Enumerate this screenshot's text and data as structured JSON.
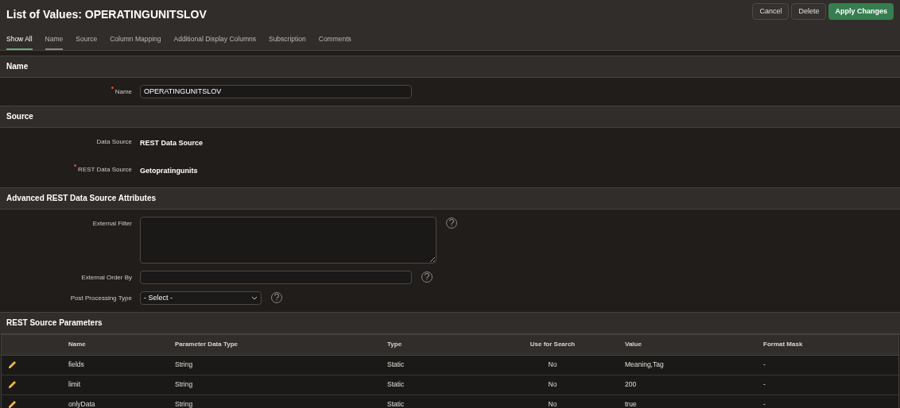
{
  "title": "List of Values: OPERATINGUNITSLOV",
  "buttons": [
    {
      "label": "Cancel",
      "kind": "plain"
    },
    {
      "label": "Delete",
      "kind": "plain"
    },
    {
      "label": "Apply Changes",
      "kind": "primary"
    }
  ],
  "tabs": [
    {
      "label": "Show All",
      "selected": true,
      "underlined": true
    },
    {
      "label": "Name",
      "selected": false,
      "underlined": true
    },
    {
      "label": "Source",
      "selected": false,
      "underlined": false
    },
    {
      "label": "Column Mapping",
      "selected": false,
      "underlined": false
    },
    {
      "label": "Additional Display Columns",
      "selected": false,
      "underlined": false
    },
    {
      "label": "Subscription",
      "selected": false,
      "underlined": false
    },
    {
      "label": "Comments",
      "selected": false,
      "underlined": false
    }
  ],
  "sections": [
    {
      "title": "Name",
      "fields": [
        {
          "label": "Name",
          "required": true,
          "kind": "input",
          "value": "OPERATINGUNITSLOV"
        }
      ]
    },
    {
      "title": "Source",
      "fields": [
        {
          "label": "Data Source",
          "required": false,
          "kind": "display",
          "value": "REST Data Source"
        },
        {
          "label": "REST Data Source",
          "required": true,
          "kind": "display",
          "value": "Getopratingunits"
        }
      ]
    },
    {
      "title": "Advanced REST Data Source Attributes",
      "fields": [
        {
          "label": "External Filter",
          "required": false,
          "kind": "textarea",
          "help": true
        },
        {
          "label": "External Order By",
          "required": false,
          "kind": "input",
          "help": true
        },
        {
          "label": "Post Processing Type",
          "required": false,
          "kind": "select",
          "value": "- Select -",
          "help": true
        }
      ]
    }
  ],
  "parameters": {
    "title": "REST Source Parameters",
    "columns": [
      "Name",
      "Parameter Data Type",
      "Type",
      "Use for Search",
      "Value",
      "Format Mask"
    ],
    "rows": [
      [
        "fields",
        "String",
        "Static",
        "No",
        "Meaning,Tag",
        "-"
      ],
      [
        "limit",
        "String",
        "Static",
        "No",
        "200",
        "-"
      ],
      [
        "onlyData",
        "String",
        "Static",
        "No",
        "true",
        "-"
      ]
    ]
  }
}
